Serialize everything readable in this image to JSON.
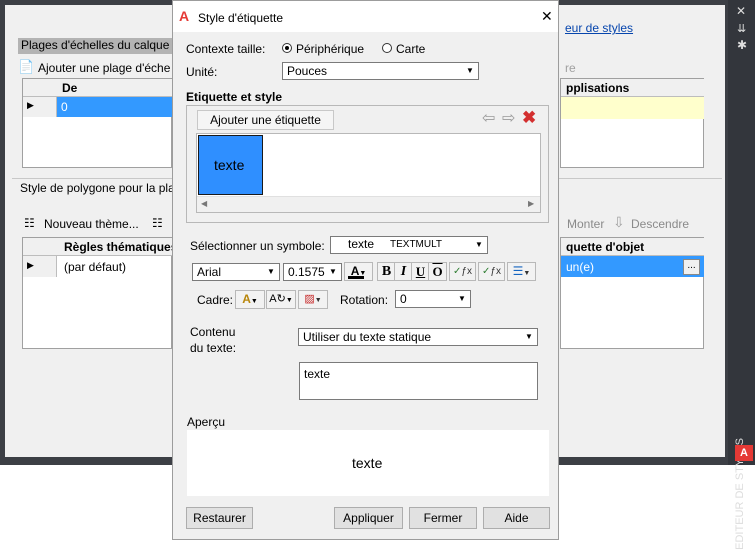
{
  "back": {
    "scale_header": "Plages d'échelles du calque S",
    "add_scale_range": "Ajouter une plage d'éche",
    "col_de": "De",
    "row_arrow": "▶",
    "row_value": "0",
    "polygon_header": "Style de polygone pour la pla",
    "new_theme": "Nouveau thème...",
    "rules_col": "Règles thématiques",
    "rule_row": "(par défaut)",
    "link": "eur de styles",
    "faded_label": "re",
    "applications_col": "pplisations",
    "move_up": "Monter",
    "move_down": "Descendre",
    "label_col": "quette d'objet",
    "label_value": "un(e)",
    "ellipsis": "...",
    "palette_title": "EDITEUR DE STYLES"
  },
  "dialog": {
    "title": "Style d'étiquette",
    "close": "✕",
    "context_label": "Contexte taille:",
    "radio_peripheral": "Périphérique",
    "radio_map": "Carte",
    "unit_label": "Unité:",
    "unit_value": "Pouces",
    "group_label": "Etiquette et style",
    "add_label": "Ajouter une étiquette",
    "label_item": "texte",
    "symbol_label": "Sélectionner un symbole:",
    "symbol_text": "texte",
    "symbol_type": "TEXTMULT",
    "font": "Arial",
    "size": "0.1575",
    "bold": "B",
    "italic": "I",
    "underline": "U",
    "overline": "O",
    "frame_label": "Cadre:",
    "rotation_label": "Rotation:",
    "rotation_value": "0",
    "content_label_1": "Contenu",
    "content_label_2": "du texte:",
    "content_value": "Utiliser du texte statique",
    "text_value": "texte",
    "preview_label": "Aperçu",
    "preview_text": "texte",
    "restore": "Restaurer",
    "apply": "Appliquer",
    "close_btn": "Fermer",
    "help": "Aide"
  },
  "colors": {
    "selection": "#3399ff",
    "dark": "#33363c",
    "highlight": "#ffffcc"
  }
}
